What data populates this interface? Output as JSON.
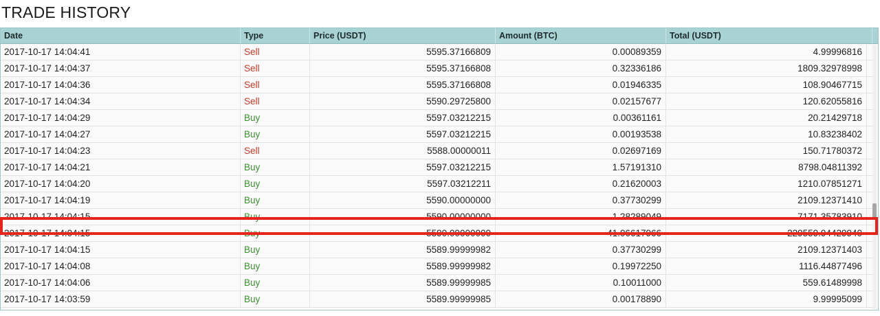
{
  "title": "TRADE HISTORY",
  "columns": [
    "Date",
    "Type",
    "Price (USDT)",
    "Amount (BTC)",
    "Total (USDT)"
  ],
  "colors": {
    "header_bg": "#a9d3d3",
    "sell": "#c0392b",
    "buy": "#3c8f2f",
    "highlight_border": "#e8231b"
  },
  "highlighted_row_index": 11,
  "rows": [
    {
      "date": "2017-10-17 14:04:41",
      "type": "Sell",
      "price": "5595.37166809",
      "amount": "0.00089359",
      "total": "4.99996816"
    },
    {
      "date": "2017-10-17 14:04:37",
      "type": "Sell",
      "price": "5595.37166808",
      "amount": "0.32336186",
      "total": "1809.32978998"
    },
    {
      "date": "2017-10-17 14:04:36",
      "type": "Sell",
      "price": "5595.37166808",
      "amount": "0.01946335",
      "total": "108.90467715"
    },
    {
      "date": "2017-10-17 14:04:34",
      "type": "Sell",
      "price": "5590.29725800",
      "amount": "0.02157677",
      "total": "120.62055816"
    },
    {
      "date": "2017-10-17 14:04:29",
      "type": "Buy",
      "price": "5597.03212215",
      "amount": "0.00361161",
      "total": "20.21429718"
    },
    {
      "date": "2017-10-17 14:04:27",
      "type": "Buy",
      "price": "5597.03212215",
      "amount": "0.00193538",
      "total": "10.83238402"
    },
    {
      "date": "2017-10-17 14:04:23",
      "type": "Sell",
      "price": "5588.00000011",
      "amount": "0.02697169",
      "total": "150.71780372"
    },
    {
      "date": "2017-10-17 14:04:21",
      "type": "Buy",
      "price": "5597.03212215",
      "amount": "1.57191310",
      "total": "8798.04811392"
    },
    {
      "date": "2017-10-17 14:04:20",
      "type": "Buy",
      "price": "5597.03212211",
      "amount": "0.21620003",
      "total": "1210.07851271"
    },
    {
      "date": "2017-10-17 14:04:19",
      "type": "Buy",
      "price": "5590.00000000",
      "amount": "0.37730299",
      "total": "2109.12371410"
    },
    {
      "date": "2017-10-17 14:04:15",
      "type": "Buy",
      "price": "5590.00000000",
      "amount": "1.28289049",
      "total": "7171.35783910"
    },
    {
      "date": "2017-10-17 14:04:15",
      "type": "Buy",
      "price": "5590.00000000",
      "amount": "41.06617966",
      "total": "229559.94429940"
    },
    {
      "date": "2017-10-17 14:04:15",
      "type": "Buy",
      "price": "5589.99999982",
      "amount": "0.37730299",
      "total": "2109.12371403"
    },
    {
      "date": "2017-10-17 14:04:08",
      "type": "Buy",
      "price": "5589.99999982",
      "amount": "0.19972250",
      "total": "1116.44877496"
    },
    {
      "date": "2017-10-17 14:04:06",
      "type": "Buy",
      "price": "5589.99999985",
      "amount": "0.10011000",
      "total": "559.61489998"
    },
    {
      "date": "2017-10-17 14:03:59",
      "type": "Buy",
      "price": "5589.99999985",
      "amount": "0.00178890",
      "total": "9.99995099"
    }
  ]
}
